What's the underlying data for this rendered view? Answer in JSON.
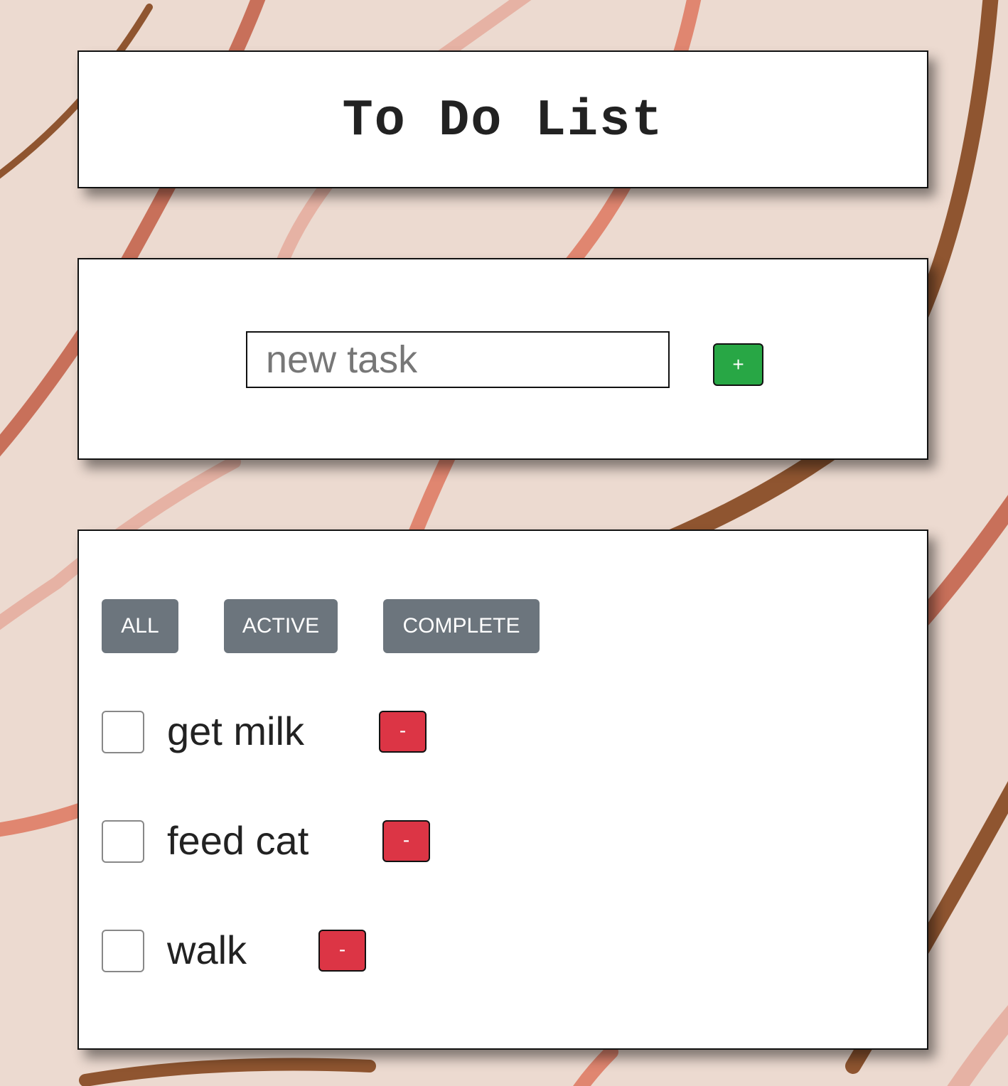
{
  "header": {
    "title": "To Do List"
  },
  "new_task": {
    "placeholder": "new task",
    "value": "",
    "add_label": "+"
  },
  "filters": {
    "all": "ALL",
    "active": "ACTIVE",
    "complete": "COMPLETE"
  },
  "tasks": [
    {
      "label": "get milk",
      "checked": false,
      "delete_label": "-"
    },
    {
      "label": "feed cat",
      "checked": false,
      "delete_label": "-"
    },
    {
      "label": "walk",
      "checked": false,
      "delete_label": "-"
    }
  ],
  "colors": {
    "background": "#ecdad0",
    "add_button": "#28a745",
    "delete_button": "#dc3545",
    "filter_button": "#6c757d",
    "swirl_brown": "#8f5530",
    "swirl_coral": "#e08670",
    "swirl_rust": "#c8705a",
    "swirl_pale": "#e6b2a4"
  }
}
